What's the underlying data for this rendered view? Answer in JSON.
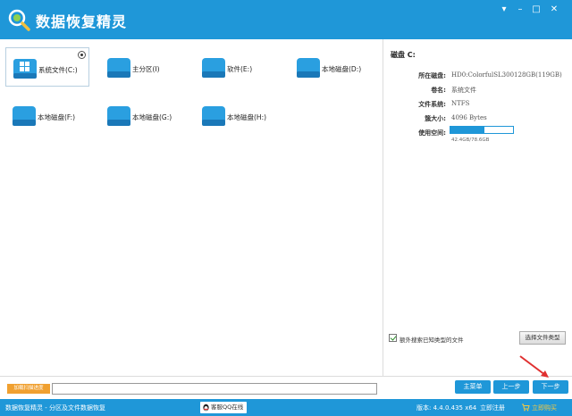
{
  "app": {
    "title": "数据恢复精灵"
  },
  "window_controls": {
    "menu_icon": "chevron-down-icon",
    "minimize_icon": "minimize-icon",
    "maximize_icon": "maximize-icon",
    "close_icon": "close-icon"
  },
  "drives": [
    {
      "label": "系统文件(C:)",
      "icon": "windows-drive-icon",
      "selected": true
    },
    {
      "label": "主分区(I)",
      "icon": "drive-icon",
      "selected": false
    },
    {
      "label": "软件(E:)",
      "icon": "drive-icon",
      "selected": false
    },
    {
      "label": "本地磁盘(D:)",
      "icon": "drive-icon",
      "selected": false
    },
    {
      "label": "本地磁盘(F:)",
      "icon": "drive-icon",
      "selected": false
    },
    {
      "label": "本地磁盘(G:)",
      "icon": "drive-icon",
      "selected": false
    },
    {
      "label": "本地磁盘(H:)",
      "icon": "drive-icon",
      "selected": false
    }
  ],
  "details": {
    "heading": "磁盘 C:",
    "rows": [
      {
        "key": "所在磁盘:",
        "value": "HD0:ColorfulSL300128GB(119GB)"
      },
      {
        "key": "卷名:",
        "value": "系统文件"
      },
      {
        "key": "文件系统:",
        "value": "NTFS"
      },
      {
        "key": "簇大小:",
        "value": "4096 Bytes"
      },
      {
        "key": "使用空间:",
        "value": ""
      }
    ],
    "usage_fraction": 0.54,
    "usage_text": "42.4GB/78.6GB",
    "extra_search_label": "额外搜索已知类型的文件",
    "extra_search_checked": true,
    "select_types_label": "选择文件类型"
  },
  "bottom": {
    "accel_label": "加载扫描进度",
    "path_value": "",
    "main_menu_label": "主菜单",
    "prev_label": "上一步",
    "next_label": "下一步"
  },
  "status": {
    "left_text": "数据恢复精灵 - 分区及文件数据恢复",
    "qq_label": "客服QQ在线",
    "version": "版本: 4.4.0.435 x64",
    "register_label": "立即注册",
    "buy_label": "立即购买"
  },
  "colors": {
    "accent": "#1f97d8",
    "accel_button": "#f0a030",
    "arrow": "#e03030"
  }
}
